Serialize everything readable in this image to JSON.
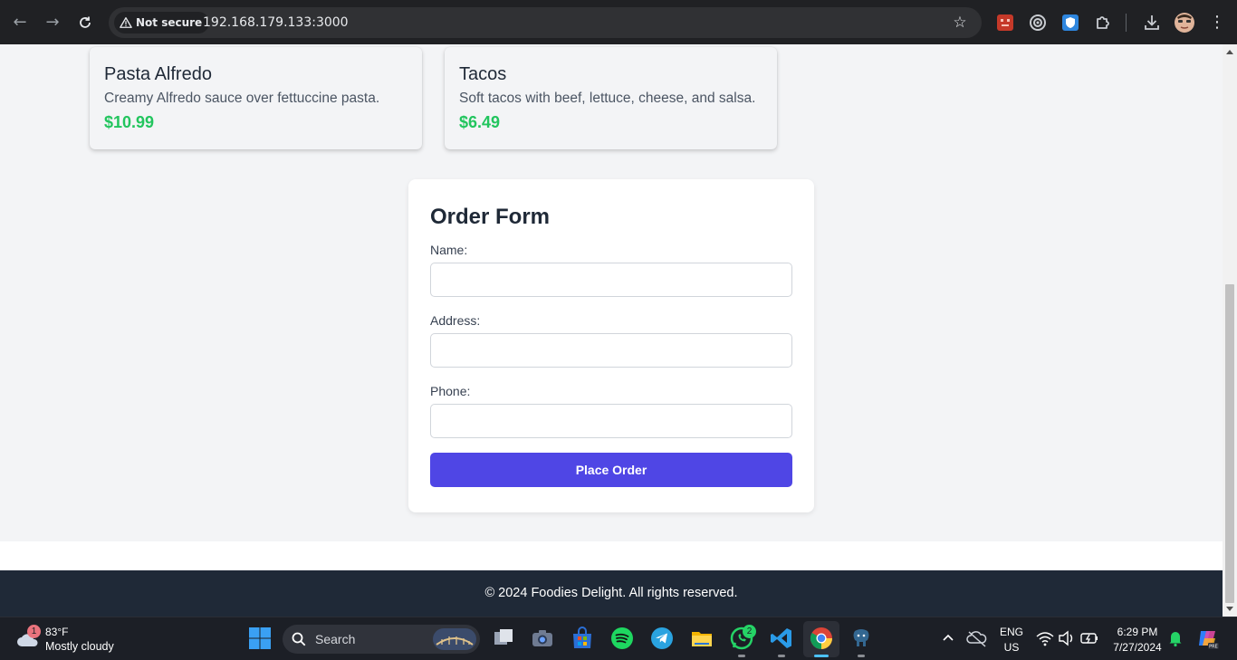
{
  "browser": {
    "security_label": "Not secure",
    "url": "192.168.179.133:3000"
  },
  "menu_items": [
    {
      "name": "Pasta Alfredo",
      "description": "Creamy Alfredo sauce over fettuccine pasta.",
      "price": "$10.99"
    },
    {
      "name": "Tacos",
      "description": "Soft tacos with beef, lettuce, cheese, and salsa.",
      "price": "$6.49"
    }
  ],
  "order_form": {
    "title": "Order Form",
    "name_label": "Name:",
    "name_value": "",
    "address_label": "Address:",
    "address_value": "",
    "phone_label": "Phone:",
    "phone_value": "",
    "submit_label": "Place Order"
  },
  "footer": {
    "text": "© 2024 Foodies Delight. All rights reserved."
  },
  "taskbar": {
    "weather_temp": "83°F",
    "weather_desc": "Mostly cloudy",
    "weather_badge": "1",
    "search_placeholder": "Search",
    "whatsapp_badge": "2",
    "language": "ENG",
    "region": "US",
    "time": "6:29 PM",
    "date": "7/27/2024"
  },
  "colors": {
    "accent": "#4f46e5",
    "price": "#22c55e",
    "footer_bg": "#1f2937"
  }
}
